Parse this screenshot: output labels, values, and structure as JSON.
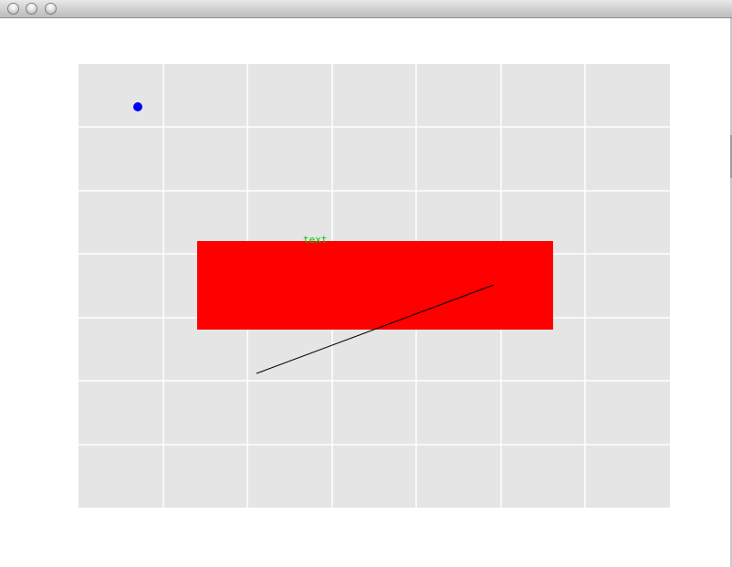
{
  "window": {
    "titlebar_buttons": [
      {
        "name": "close-button",
        "icon": "traffic-light-close-icon"
      },
      {
        "name": "minimize-button",
        "icon": "traffic-light-minimize-icon"
      },
      {
        "name": "zoom-button",
        "icon": "traffic-light-zoom-icon"
      }
    ]
  },
  "canvas": {
    "plot_bg_color": "#e5e5e5",
    "grid_color": "#ffffff",
    "grid": {
      "columns": 7,
      "rows": 7,
      "shown": true
    },
    "shapes": {
      "point_color": "#0000ff",
      "rect_color": "#ff0000",
      "line_color": "#000000",
      "text_color": "#00cc00",
      "text_label": "text"
    }
  }
}
